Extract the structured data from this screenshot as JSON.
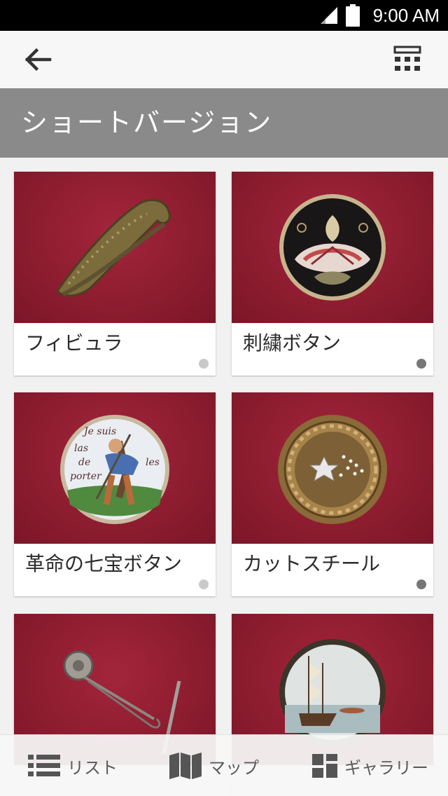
{
  "status_bar": {
    "time": "9:00 AM",
    "icons": [
      "signal-icon",
      "battery-icon"
    ]
  },
  "app_bar": {
    "back_icon": "arrow-left-icon",
    "layout_icon": "grid-layout-icon"
  },
  "header": {
    "title": "ショートバージョン"
  },
  "items": [
    {
      "label": "フィビュラ",
      "image": "fibula-brooch",
      "indicator": "light"
    },
    {
      "label": "刺繍ボタン",
      "image": "embroidered-button",
      "indicator": "dark"
    },
    {
      "label": "革命の七宝ボタン",
      "image": "enamel-button",
      "indicator": "light"
    },
    {
      "label": "カットスチール",
      "image": "cut-steel-button",
      "indicator": "dark"
    },
    {
      "label": "",
      "image": "pin-brooch",
      "indicator": ""
    },
    {
      "label": "",
      "image": "ship-button",
      "indicator": ""
    }
  ],
  "enamel_text": [
    "Je suis",
    "las",
    "de",
    "porter",
    "les"
  ],
  "bottom_nav": {
    "list": "リスト",
    "map": "マップ",
    "gallery": "ギャラリー"
  },
  "colors": {
    "background_red": "#8c1c2f",
    "title_band": "#8a8a8a",
    "indicator_light": "#c9c9c9",
    "indicator_dark": "#777777"
  }
}
